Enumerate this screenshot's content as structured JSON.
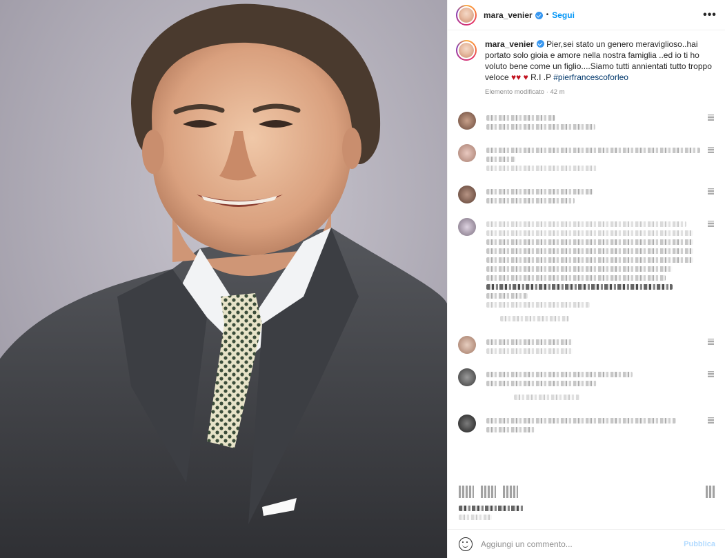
{
  "header": {
    "username": "mara_venier",
    "separator": "•",
    "follow_label": "Segui",
    "more_label": "•••"
  },
  "caption": {
    "username": "mara_venier",
    "text_part1": "Pier,sei stato un genero meraviglioso..hai portato solo gioia e amore nella nostra famiglia ..ed io ti ho voluto bene come un figlio....Siamo tutti annientati tutto troppo veloce",
    "hearts1": "♥♥",
    "hearts2": "♥",
    "text_part2": "R.I .P",
    "hashtag": "#pierfrancescoforleo",
    "meta": "Elemento modificato · 42 m"
  },
  "comment_box": {
    "placeholder": "Aggiungi un commento...",
    "publish_label": "Pubblica"
  },
  "colors": {
    "accent": "#0095f6",
    "hashtag": "#00376b",
    "verified": "#3897f0",
    "meta_text": "#8e8e8e",
    "publish_disabled": "#b3dbff"
  },
  "icons": [
    "verified-badge-icon",
    "more-options-icon",
    "emoji-icon",
    "heart-icon"
  ]
}
